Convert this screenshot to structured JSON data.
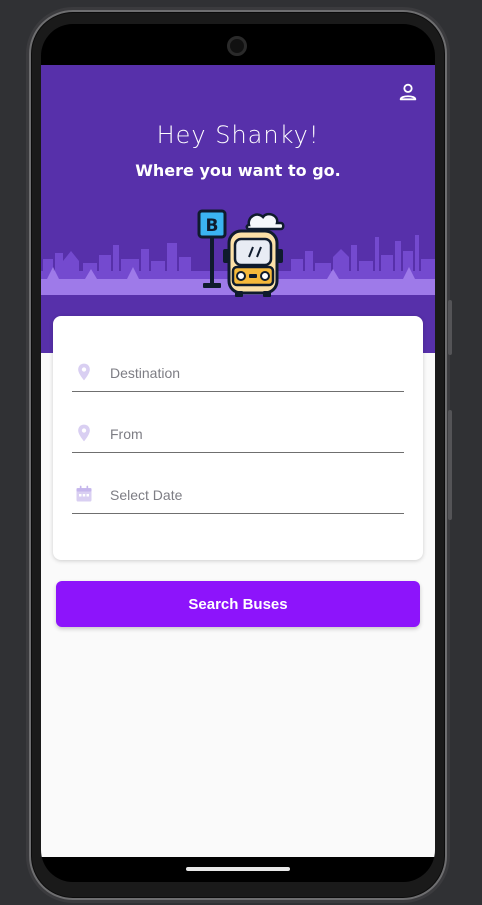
{
  "header": {
    "greeting": "Hey Shanky!",
    "subtitle": "Where you want to go.",
    "profile_icon": "person-icon",
    "background_color": "#5730aa"
  },
  "form": {
    "destination": {
      "placeholder": "Destination",
      "icon": "location-pin-icon"
    },
    "from": {
      "placeholder": "From",
      "icon": "location-pin-icon"
    },
    "date": {
      "placeholder": "Select Date",
      "icon": "calendar-icon"
    }
  },
  "search_button": {
    "label": "Search Buses",
    "color": "#8d14fb"
  },
  "illustration": {
    "bus_stop_sign": "B"
  }
}
